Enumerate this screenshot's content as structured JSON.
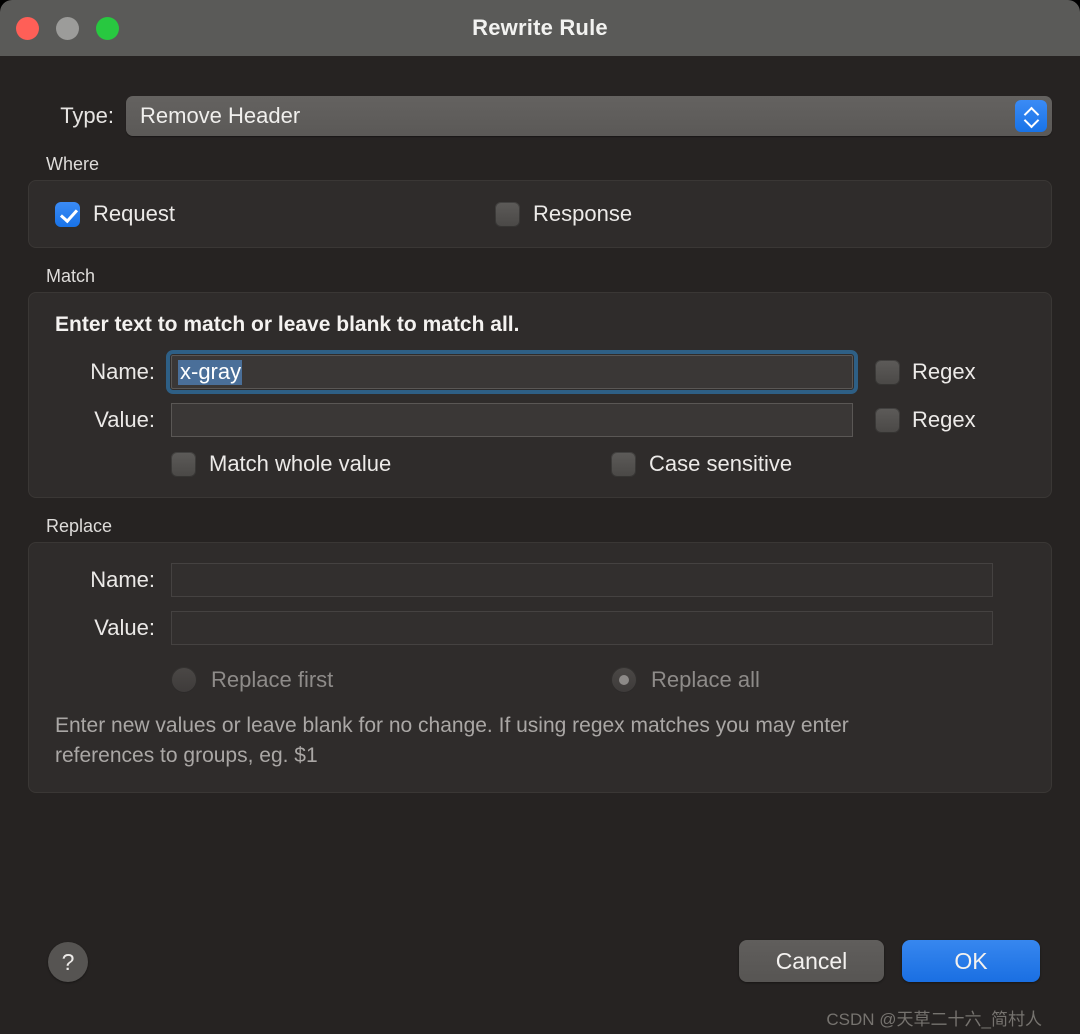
{
  "window": {
    "title": "Rewrite Rule",
    "traffic_lights": [
      "close",
      "minimize",
      "zoom"
    ]
  },
  "type_row": {
    "label": "Type:",
    "selected": "Remove Header",
    "stepper_icon": "up-down-chevron-icon"
  },
  "where": {
    "legend": "Where",
    "options": [
      {
        "label": "Request",
        "checked": true
      },
      {
        "label": "Response",
        "checked": false
      }
    ]
  },
  "match": {
    "legend": "Match",
    "hint": "Enter text to match or leave blank to match all.",
    "name": {
      "label": "Name:",
      "value": "x-gray",
      "selected": true,
      "focused": true,
      "regex_label": "Regex",
      "regex_checked": false
    },
    "value": {
      "label": "Value:",
      "value": "",
      "regex_label": "Regex",
      "regex_checked": false
    },
    "options": [
      {
        "label": "Match whole value",
        "checked": false
      },
      {
        "label": "Case sensitive",
        "checked": false
      }
    ]
  },
  "replace": {
    "legend": "Replace",
    "enabled": false,
    "name": {
      "label": "Name:",
      "value": ""
    },
    "value": {
      "label": "Value:",
      "value": ""
    },
    "radios": [
      {
        "label": "Replace first",
        "selected": false
      },
      {
        "label": "Replace all",
        "selected": true
      }
    ],
    "hint": "Enter new values or leave blank for no change. If using regex matches you may enter references to groups, eg. $1"
  },
  "footer": {
    "help_label": "?",
    "cancel_label": "Cancel",
    "ok_label": "OK"
  },
  "watermark": "CSDN @天草二十六_简村人",
  "colors": {
    "accent_blue": "#1873e8",
    "titlebar": "#5a5a58",
    "window_bg": "#262322",
    "group_bg": "#2f2c2b",
    "selection_blue": "#4a6f99",
    "focus_ring": "#2e5f85",
    "close_red": "#ff5f57",
    "min_gray": "#9c9c9a",
    "zoom_green": "#28c840"
  }
}
